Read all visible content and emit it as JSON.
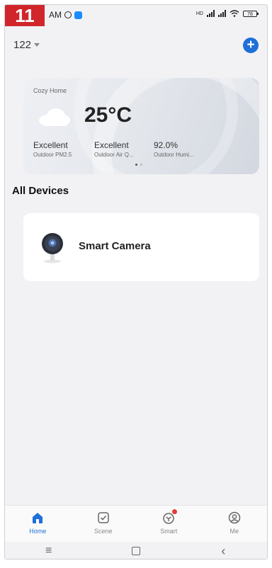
{
  "step_badge": "11",
  "status_bar": {
    "time": "AM",
    "battery": "78",
    "network": "HD"
  },
  "header": {
    "home_name": "122",
    "add_label": "+"
  },
  "weather": {
    "title": "Cozy Home",
    "temperature": "25°C",
    "metrics": [
      {
        "value": "Excellent",
        "label": "Outdoor PM2.5"
      },
      {
        "value": "Excellent",
        "label": "Outdoor Air Q..."
      },
      {
        "value": "92.0%",
        "label": "Outdoor Humi..."
      }
    ]
  },
  "section": {
    "title": "All Devices"
  },
  "devices": [
    {
      "name": "Smart Camera",
      "icon": "camera-icon"
    }
  ],
  "tabs": [
    {
      "label": "Home",
      "icon": "home-icon",
      "active": true
    },
    {
      "label": "Scene",
      "icon": "scene-icon",
      "active": false
    },
    {
      "label": "Smart",
      "icon": "smart-icon",
      "active": false
    },
    {
      "label": "Me",
      "icon": "profile-icon",
      "active": false
    }
  ],
  "colors": {
    "accent": "#1f6fd8",
    "badge": "#d0262b",
    "notification": "#e53935"
  },
  "nav": {
    "menu_symbol": "≡",
    "back_symbol": "‹"
  }
}
